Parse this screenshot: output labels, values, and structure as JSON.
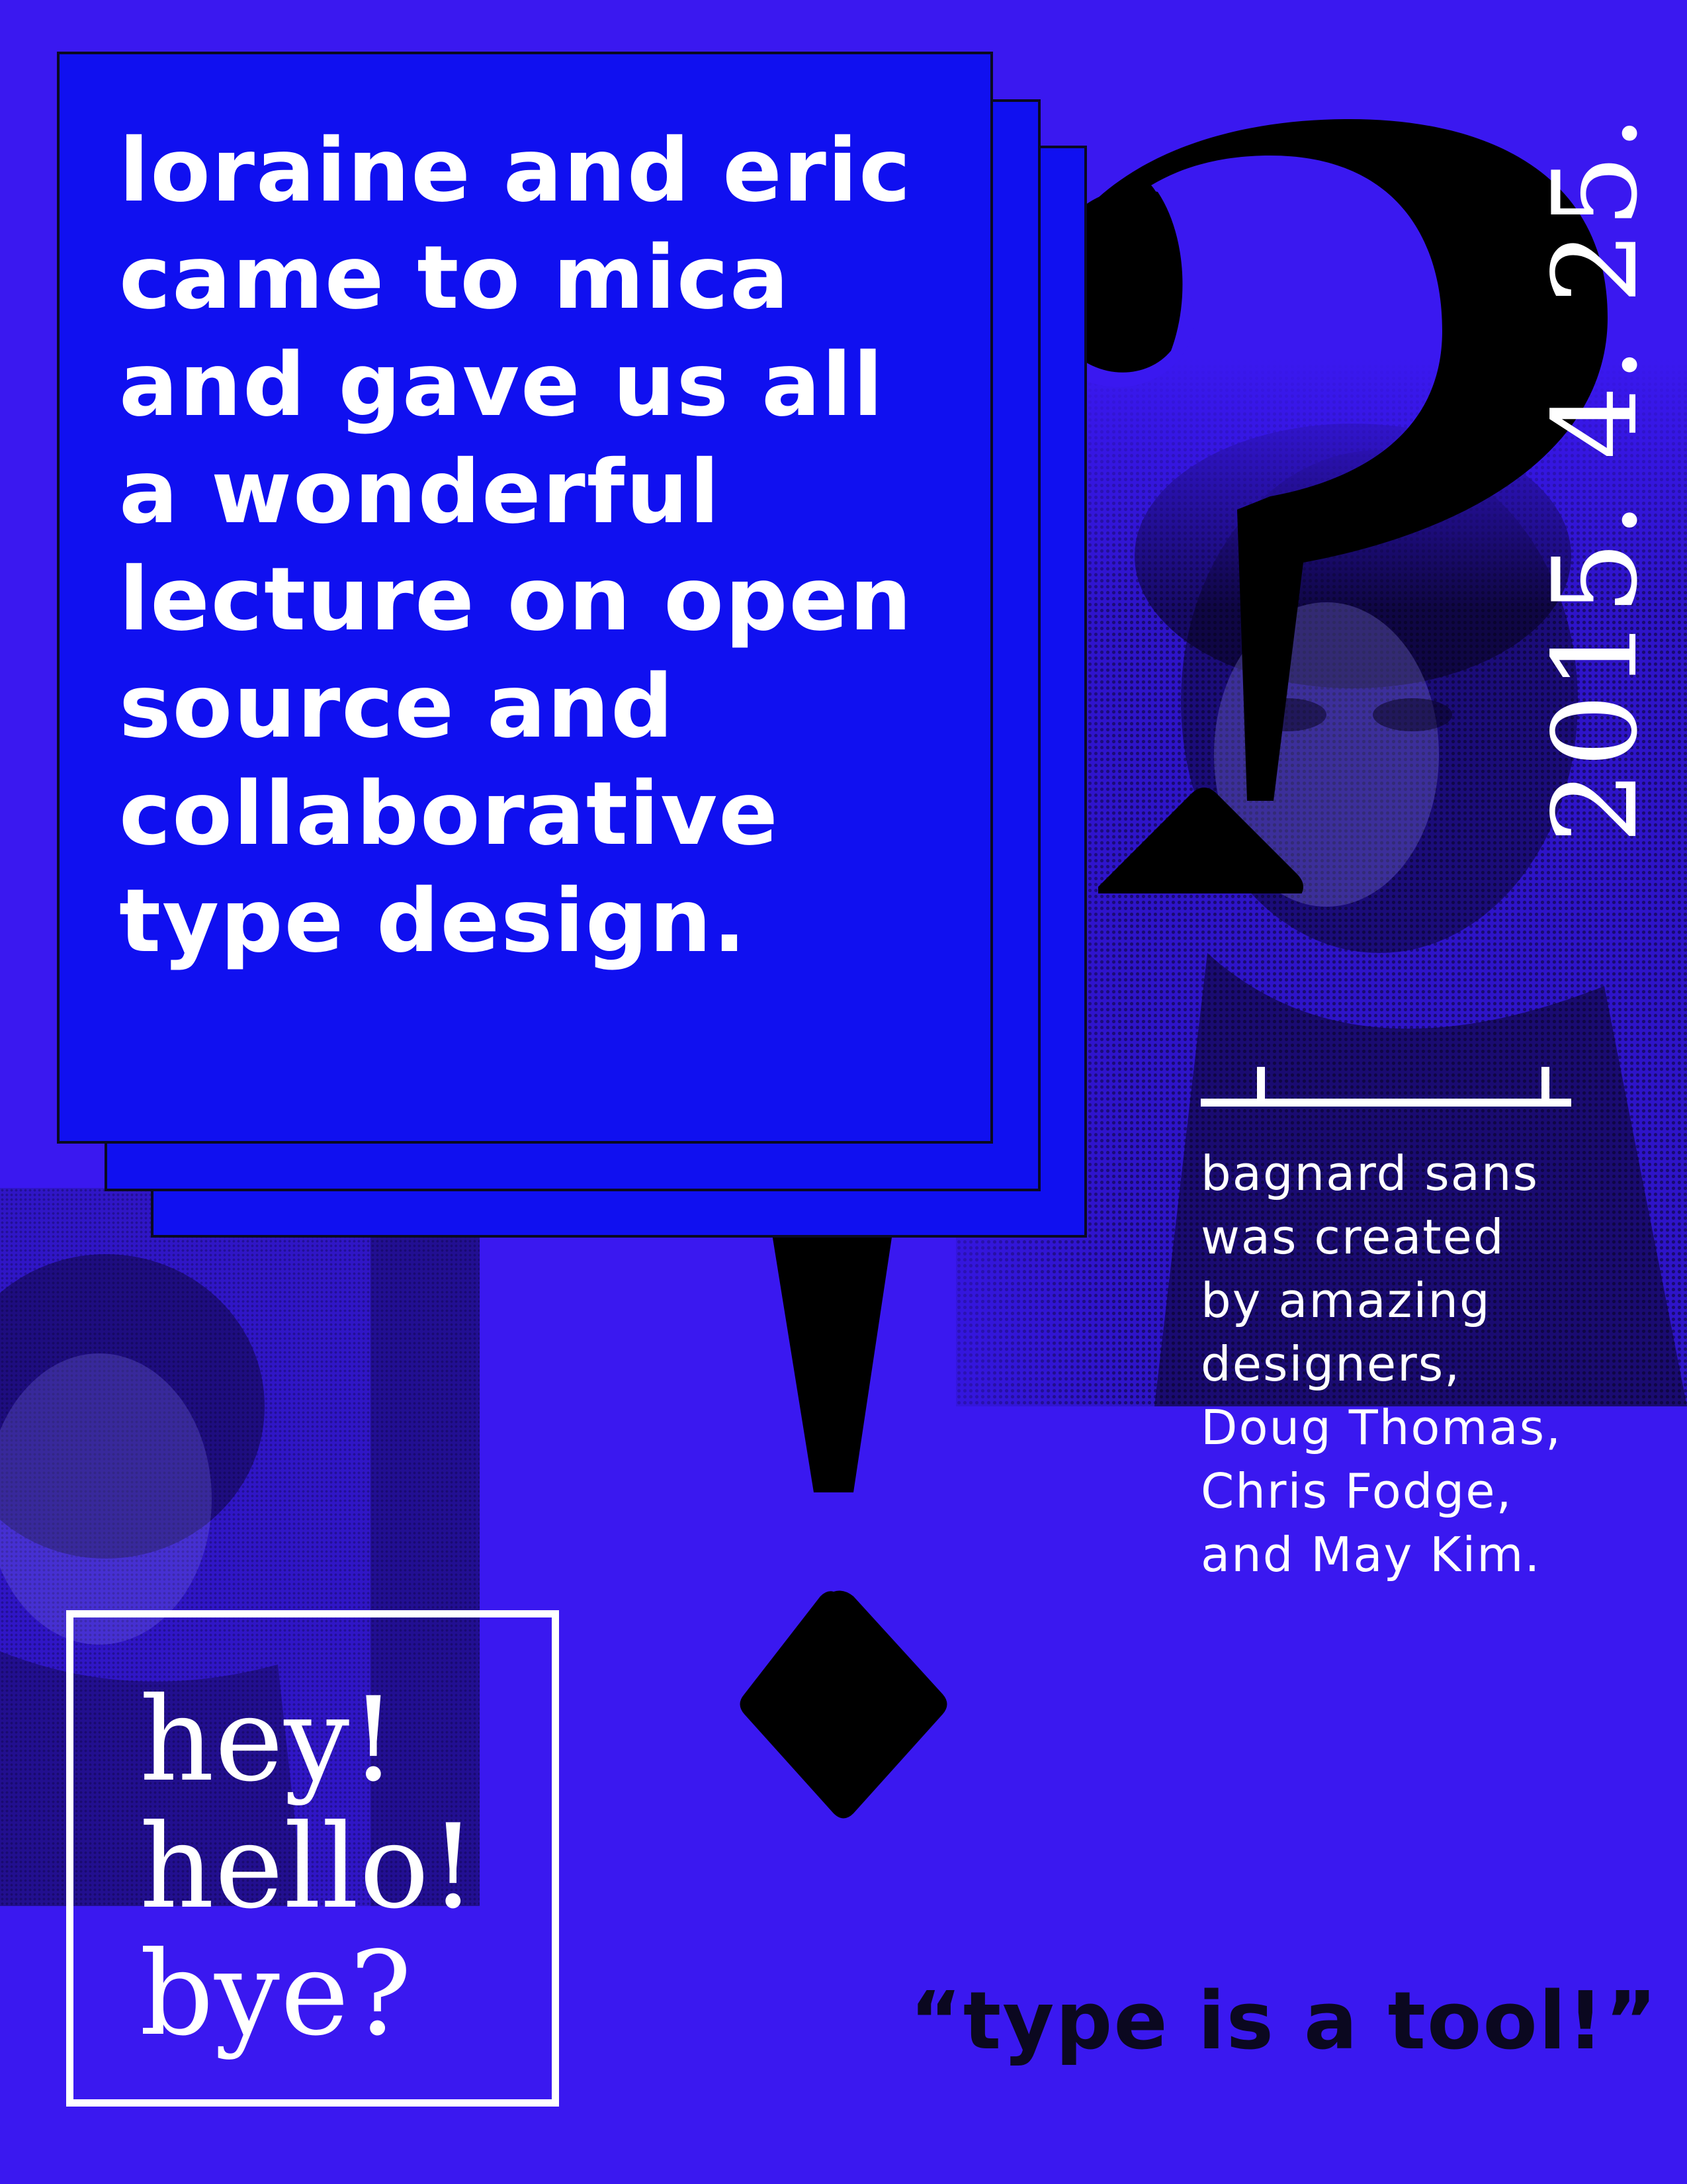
{
  "poster": {
    "background_color": "#3a18f0",
    "panel_color": "#1010f0",
    "ink_color": "#0b0820",
    "text_color": "#ffffff",
    "lecture_lines": [
      "loraine and eric",
      "came to mica",
      "and gave us all",
      "a wonderful",
      "lecture on open",
      "source and",
      "collaborative",
      "type design."
    ],
    "date": "2015. 4. 25.",
    "credits_lines": [
      "bagnard sans",
      "was created",
      "by amazing",
      "designers,",
      "Doug Thomas,",
      "Chris Fodge,",
      "and May Kim."
    ],
    "greeting_lines": [
      "hey!",
      "hello!",
      "bye?"
    ],
    "quote": "“type is a tool!”",
    "icons": {
      "question_glyph": "question-mark-glyph",
      "exclaim_glyph": "exclamation-mark-glyph"
    }
  }
}
